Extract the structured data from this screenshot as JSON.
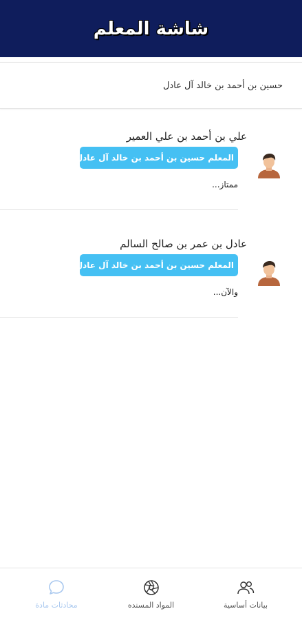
{
  "header": {
    "title": "شاشة المعلم"
  },
  "teacher": {
    "name": "حسين بن أحمد بن خالد آل عادل"
  },
  "chats": [
    {
      "student_name": "علي بن أحمد بن علي العمير",
      "badge": "المعلم حسين بن أحمد بن خالد آل عادل",
      "last_message": "ممتاز..."
    },
    {
      "student_name": "عادل بن عمر بن صالح السالم",
      "badge": "المعلم حسين بن أحمد بن خالد آل عادل",
      "last_message": "والآن..."
    }
  ],
  "bottom_nav": {
    "items": [
      {
        "label": "محادثات مادة",
        "icon": "chat-bubble-icon",
        "active": true
      },
      {
        "label": "المواد المسنده",
        "icon": "aperture-icon",
        "active": false
      },
      {
        "label": "بيانات أساسية",
        "icon": "users-icon",
        "active": false
      }
    ]
  },
  "colors": {
    "header_bg": "#0f1d5c",
    "badge_bg": "#45c0f3",
    "active_nav": "#a9c8ef"
  }
}
